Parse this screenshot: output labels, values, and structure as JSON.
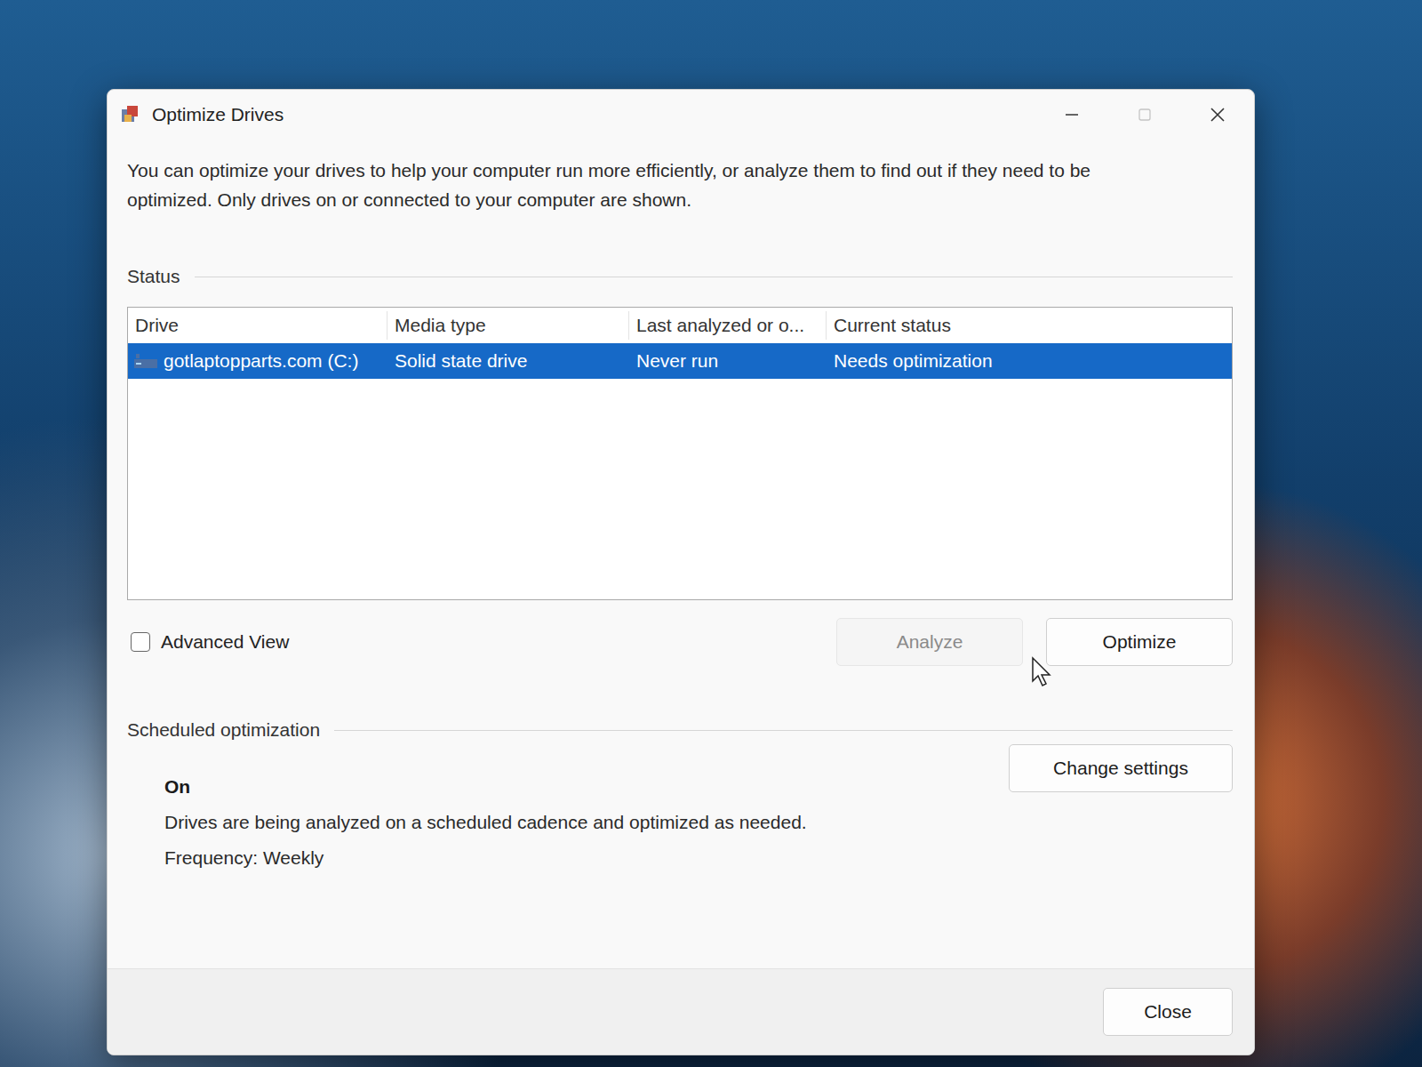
{
  "window": {
    "title": "Optimize Drives",
    "controls": [
      {
        "kind": "minimize",
        "disabled": false
      },
      {
        "kind": "maximize",
        "disabled": true
      },
      {
        "kind": "close",
        "disabled": false
      }
    ]
  },
  "description": "You can optimize your drives to help your computer run more efficiently, or analyze them to find out if they need to be optimized. Only drives on or connected to your computer are shown.",
  "status": {
    "label": "Status",
    "columns": [
      "Drive",
      "Media type",
      "Last analyzed or o...",
      "Current status"
    ],
    "rows": [
      {
        "drive": "gotlaptopparts.com (C:)",
        "media_type": "Solid state drive",
        "last_run": "Never run",
        "current_status": "Needs optimization",
        "selected": true
      }
    ]
  },
  "advanced_view": {
    "label": "Advanced View",
    "checked": false
  },
  "actions": [
    {
      "label": "Analyze",
      "disabled": true
    },
    {
      "label": "Optimize",
      "disabled": false
    }
  ],
  "scheduled": {
    "label": "Scheduled optimization",
    "state": "On",
    "description": "Drives are being analyzed on a scheduled cadence and optimized as needed.",
    "frequency": "Frequency: Weekly",
    "button": "Change settings"
  },
  "footer": {
    "button": "Close"
  }
}
